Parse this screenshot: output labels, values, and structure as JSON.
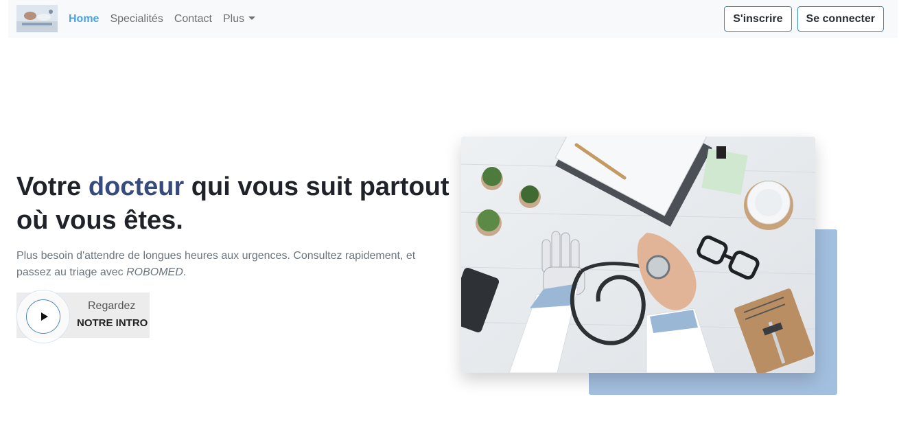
{
  "navbar": {
    "links": [
      {
        "label": "Home",
        "active": true
      },
      {
        "label": "Specialités",
        "active": false
      },
      {
        "label": "Contact",
        "active": false
      },
      {
        "label": "Plus",
        "active": false,
        "dropdown": true
      }
    ],
    "signup_label": "S'inscrire",
    "login_label": "Se connecter"
  },
  "hero": {
    "title_pre": "Votre ",
    "title_accent": "docteur",
    "title_post": " qui vous suit partout où vous êtes.",
    "description_pre": "Plus besoin d'attendre de longues heures aux urgences. Consultez rapidement, et passez au triage avec ",
    "description_brand": "ROBOMED",
    "description_post": ".",
    "intro_top": "Regardez",
    "intro_bottom": "NOTRE INTRO"
  },
  "colors": {
    "accent_title": "#374b7c",
    "nav_active": "#4aa3dc",
    "button_border": "#3a8fbf",
    "image_backdrop": "#a3bfdf"
  },
  "icons": {
    "play": "play-icon",
    "dropdown": "caret-down-icon"
  }
}
